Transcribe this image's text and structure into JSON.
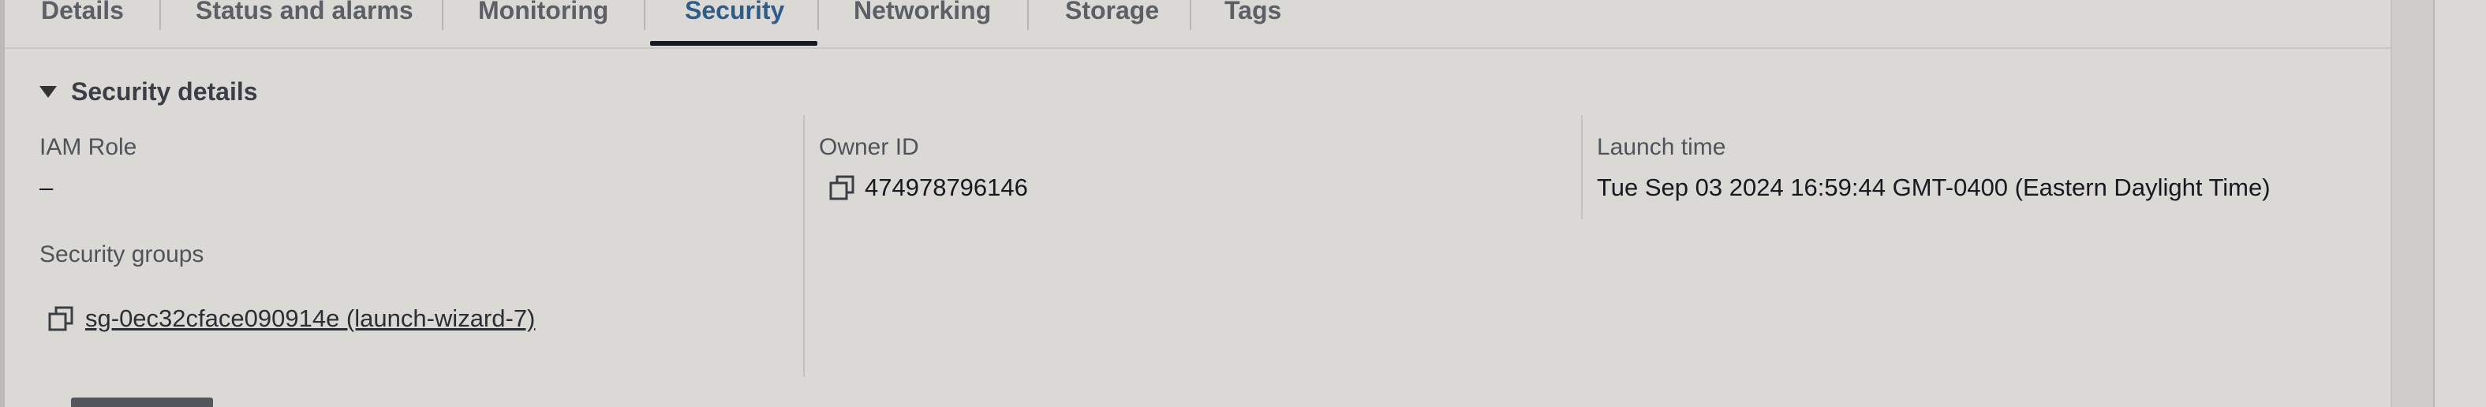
{
  "tabs": [
    {
      "label": "Details"
    },
    {
      "label": "Status and alarms"
    },
    {
      "label": "Monitoring"
    },
    {
      "label": "Security",
      "active": true
    },
    {
      "label": "Networking"
    },
    {
      "label": "Storage"
    },
    {
      "label": "Tags"
    }
  ],
  "security_details": {
    "title": "Security details",
    "iam_role": {
      "label": "IAM Role",
      "value": "–"
    },
    "owner_id": {
      "label": "Owner ID",
      "value": "474978796146",
      "icon": "copy-icon"
    },
    "launch_time": {
      "label": "Launch time",
      "value": "Tue Sep 03 2024 16:59:44 GMT-0400 (Eastern Daylight Time)"
    },
    "security_groups": {
      "label": "Security groups",
      "value": "sg-0ec32cface090914e (launch-wizard-7)",
      "icon": "copy-icon"
    }
  },
  "colors": {
    "background": "#dbd9d5",
    "active_tab": "#2e5d8a",
    "text": "#16191f",
    "muted_text": "#5c6066"
  }
}
